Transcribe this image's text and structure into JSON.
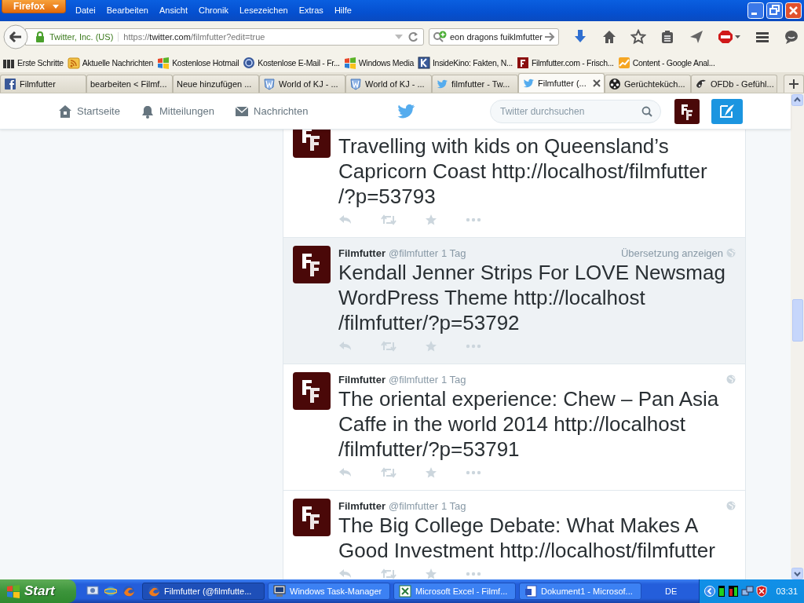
{
  "window": {
    "app_button": "Firefox",
    "menu": [
      "Datei",
      "Bearbeiten",
      "Ansicht",
      "Chronik",
      "Lesezeichen",
      "Extras",
      "Hilfe"
    ]
  },
  "navbar": {
    "identity": "Twitter, Inc. (US)",
    "url_scheme": "https://",
    "url_host": "twitter.com",
    "url_path": "/filmfutter?edit=true",
    "search_value": "eon dragons fuiklmfutter"
  },
  "bookmarks": [
    {
      "kind": "bars",
      "label": "Erste Schritte"
    },
    {
      "kind": "rss",
      "label": "Aktuelle Nachrichten"
    },
    {
      "kind": "windows",
      "label": "Kostenlose Hotmail"
    },
    {
      "kind": "globe",
      "label": "Kostenlose E-Mail - Fr..."
    },
    {
      "kind": "windows",
      "label": "Windows Media"
    },
    {
      "kind": "bluesquare",
      "label": "InsideKino: Fakten, N..."
    },
    {
      "kind": "redsquare",
      "label": "Filmfutter.com - Frisch..."
    },
    {
      "kind": "chart",
      "label": "Content - Google Anal..."
    }
  ],
  "tabs": [
    {
      "kind": "facebook",
      "label": "Filmfutter",
      "selected": false
    },
    {
      "kind": "none",
      "label": "bearbeiten < Filmf...",
      "selected": false
    },
    {
      "kind": "none",
      "label": "Neue hinzufügen ...",
      "selected": false
    },
    {
      "kind": "w",
      "label": "World of KJ - ...",
      "selected": false
    },
    {
      "kind": "w",
      "label": "World of KJ - ...",
      "selected": false
    },
    {
      "kind": "bird",
      "label": "filmfutter - Tw...",
      "selected": false
    },
    {
      "kind": "bird",
      "label": "Filmfutter (...",
      "selected": true
    },
    {
      "kind": "reel",
      "label": "Gerüchteküch...",
      "selected": false
    },
    {
      "kind": "ofdb",
      "label": "OFDb - Gefühl...",
      "selected": false
    }
  ],
  "site_header": {
    "nav": [
      {
        "kind": "home",
        "label": "Startseite"
      },
      {
        "kind": "bell",
        "label": "Mitteilungen"
      },
      {
        "kind": "mail",
        "label": "Nachrichten"
      }
    ],
    "search": {
      "placeholder": "Twitter durchsuchen"
    }
  },
  "tweets": [
    {
      "text": "Travelling with kids on Queensland’s Capricorn Coast http://localhost/filmfutter/?p=53793",
      "highlighted": false
    },
    {
      "name": "Filmfutter",
      "handle": "@filmfutter",
      "time": "1 Tag",
      "translate": "Übersetzung anzeigen",
      "text": "Kendall Jenner Strips For LOVE Newsmag WordPress Theme http://localhost/filmfutter/?p=53792",
      "highlighted": true
    },
    {
      "name": "Filmfutter",
      "handle": "@filmfutter",
      "time": "1 Tag",
      "text": "The oriental experience: Chew – Pan Asia Caffe in the world 2014 http://localhost/filmfutter/?p=53791",
      "highlighted": false
    },
    {
      "name": "Filmfutter",
      "handle": "@filmfutter",
      "time": "1 Tag",
      "text": "The Big College Debate: What Makes A Good Investment http://localhost/filmfutter",
      "highlighted": false
    }
  ],
  "taskbar": {
    "start": "Start",
    "tasks": [
      {
        "kind": "firefox",
        "label": "Filmfutter (@filmfutte...",
        "selected": true
      },
      {
        "kind": "monitor",
        "label": "Windows Task-Manager",
        "selected": false
      },
      {
        "kind": "excel",
        "label": "Microsoft Excel - Filmf...",
        "selected": false
      },
      {
        "kind": "word",
        "label": "Dokument1 - Microsof...",
        "selected": false
      }
    ],
    "language": "DE",
    "clock": "03:31"
  }
}
